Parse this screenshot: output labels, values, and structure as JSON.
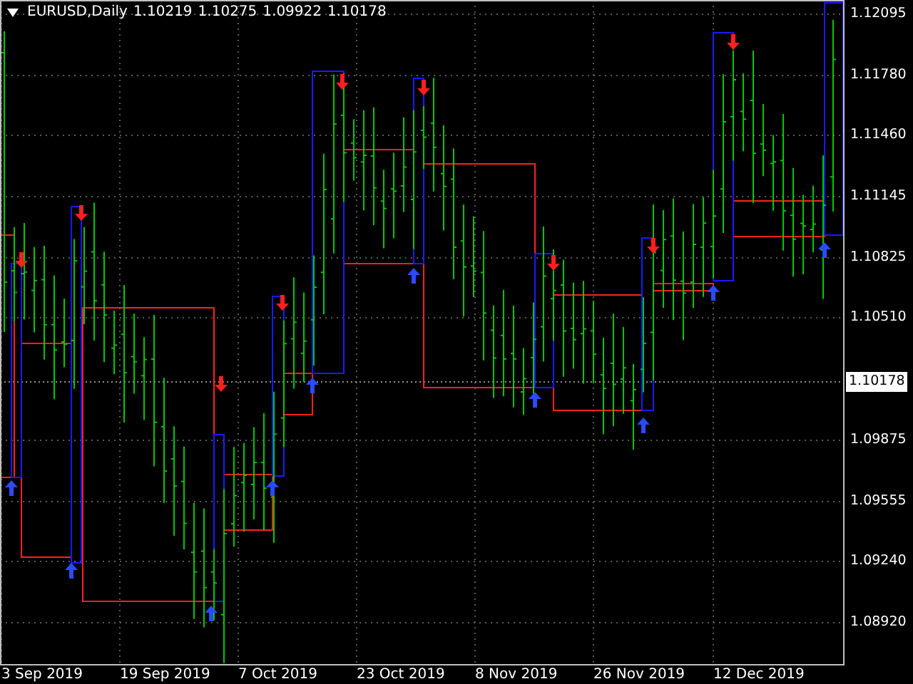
{
  "chart": {
    "symbol": "EURUSD,Daily",
    "quote": [
      "1.10219",
      "1.10275",
      "1.09922",
      "1.10178"
    ],
    "price_labels": [
      "1.12095",
      "1.11780",
      "1.11460",
      "1.11145",
      "1.10825",
      "1.10510",
      "1.09875",
      "1.09555",
      "1.09240",
      "1.08920"
    ],
    "current_price": "1.10178",
    "date_labels": [
      "3 Sep 2019",
      "19 Sep 2019",
      "7 Oct 2019",
      "23 Oct 2019",
      "8 Nov 2019",
      "26 Nov 2019",
      "12 Dec 2019"
    ]
  }
}
